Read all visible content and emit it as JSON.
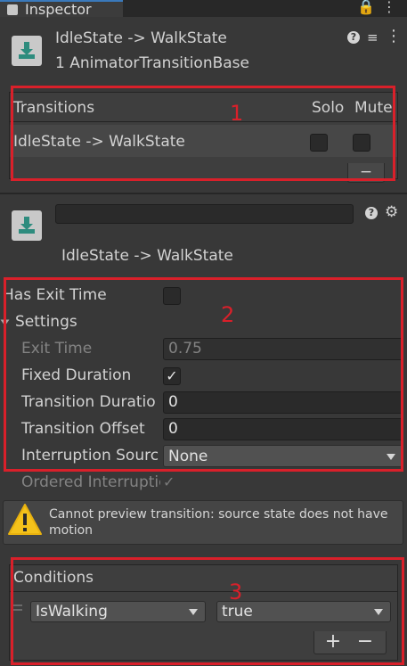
{
  "tab": {
    "label": "Inspector"
  },
  "header": {
    "title": "IdleState -> WalkState",
    "subtitle": "1 AnimatorTransitionBase"
  },
  "transitions": {
    "heading": "Transitions",
    "solo_label": "Solo",
    "mute_label": "Mute",
    "row_label": "IdleState -> WalkState",
    "remove_label": "−"
  },
  "transition": {
    "name_value": "",
    "title": "IdleState -> WalkState"
  },
  "fields": {
    "has_exit_time_label": "Has Exit Time",
    "settings_label": "Settings",
    "exit_time_label": "Exit Time",
    "exit_time_value": "0.75",
    "fixed_duration_label": "Fixed Duration",
    "transition_duration_label": "Transition Duratio",
    "transition_duration_value": "0",
    "transition_offset_label": "Transition Offset",
    "transition_offset_value": "0",
    "interruption_source_label": "Interruption Sourc",
    "interruption_source_value": "None",
    "ordered_interruption_label": "Ordered Interruptic"
  },
  "warning": {
    "text": "Cannot preview transition: source state does not have motion"
  },
  "conditions": {
    "heading": "Conditions",
    "parameter": "IsWalking",
    "value": "true",
    "add_label": "+",
    "remove_label": "−"
  },
  "annotations": {
    "box1": "1",
    "box2": "2",
    "box3": "3"
  },
  "colors": {
    "background": "#383838",
    "annotation_red": "#d9202a",
    "warning_yellow": "#f4c21b"
  }
}
